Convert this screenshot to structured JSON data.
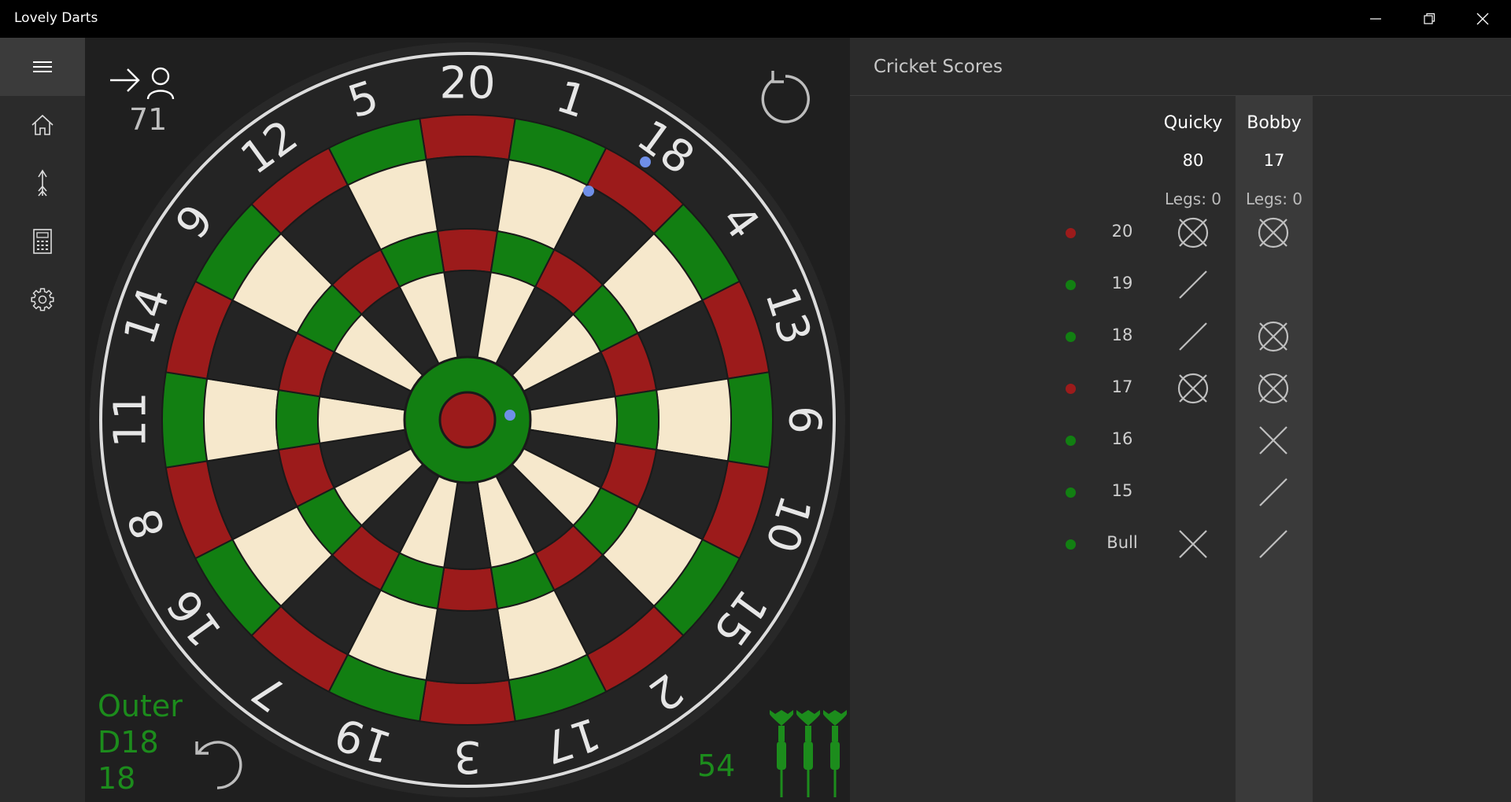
{
  "window": {
    "title": "Lovely Darts"
  },
  "titlebar_buttons": [
    "minimize-icon",
    "restore-icon",
    "close-icon"
  ],
  "nav": {
    "items": [
      {
        "name": "hamburger-menu-icon"
      },
      {
        "name": "home-icon"
      },
      {
        "name": "darts-icon"
      },
      {
        "name": "calculator-icon"
      },
      {
        "name": "settings-gear-icon"
      }
    ]
  },
  "board": {
    "current_player_score": "71",
    "last_hit": {
      "ring": "Outer",
      "segment": "D18",
      "points": "18"
    },
    "darts_remaining_score": "54",
    "number_order": [
      "20",
      "1",
      "18",
      "4",
      "13",
      "6",
      "10",
      "15",
      "2",
      "17",
      "3",
      "19",
      "7",
      "16",
      "8",
      "11",
      "14",
      "9",
      "12",
      "5"
    ],
    "colors": {
      "red": "#9c1b1b",
      "green": "#127f12",
      "cream": "#f6e8cc",
      "black": "#242424",
      "wire": "#c9c9c9",
      "hit_marker": "#6f8fe8",
      "accent_text": "#1c8c1c"
    }
  },
  "scores": {
    "title": "Cricket Scores",
    "players": [
      {
        "name": "Quicky",
        "points": "80",
        "legs": "Legs: 0"
      },
      {
        "name": "Bobby",
        "points": "17",
        "legs": "Legs: 0"
      }
    ],
    "rows": [
      {
        "label": "20",
        "dot": "red",
        "marks": [
          3,
          3
        ]
      },
      {
        "label": "19",
        "dot": "green",
        "marks": [
          1,
          0
        ]
      },
      {
        "label": "18",
        "dot": "green",
        "marks": [
          1,
          3
        ]
      },
      {
        "label": "17",
        "dot": "red",
        "marks": [
          3,
          3
        ]
      },
      {
        "label": "16",
        "dot": "green",
        "marks": [
          0,
          2
        ]
      },
      {
        "label": "15",
        "dot": "green",
        "marks": [
          0,
          1
        ]
      },
      {
        "label": "Bull",
        "dot": "green",
        "marks": [
          2,
          1
        ]
      }
    ]
  }
}
